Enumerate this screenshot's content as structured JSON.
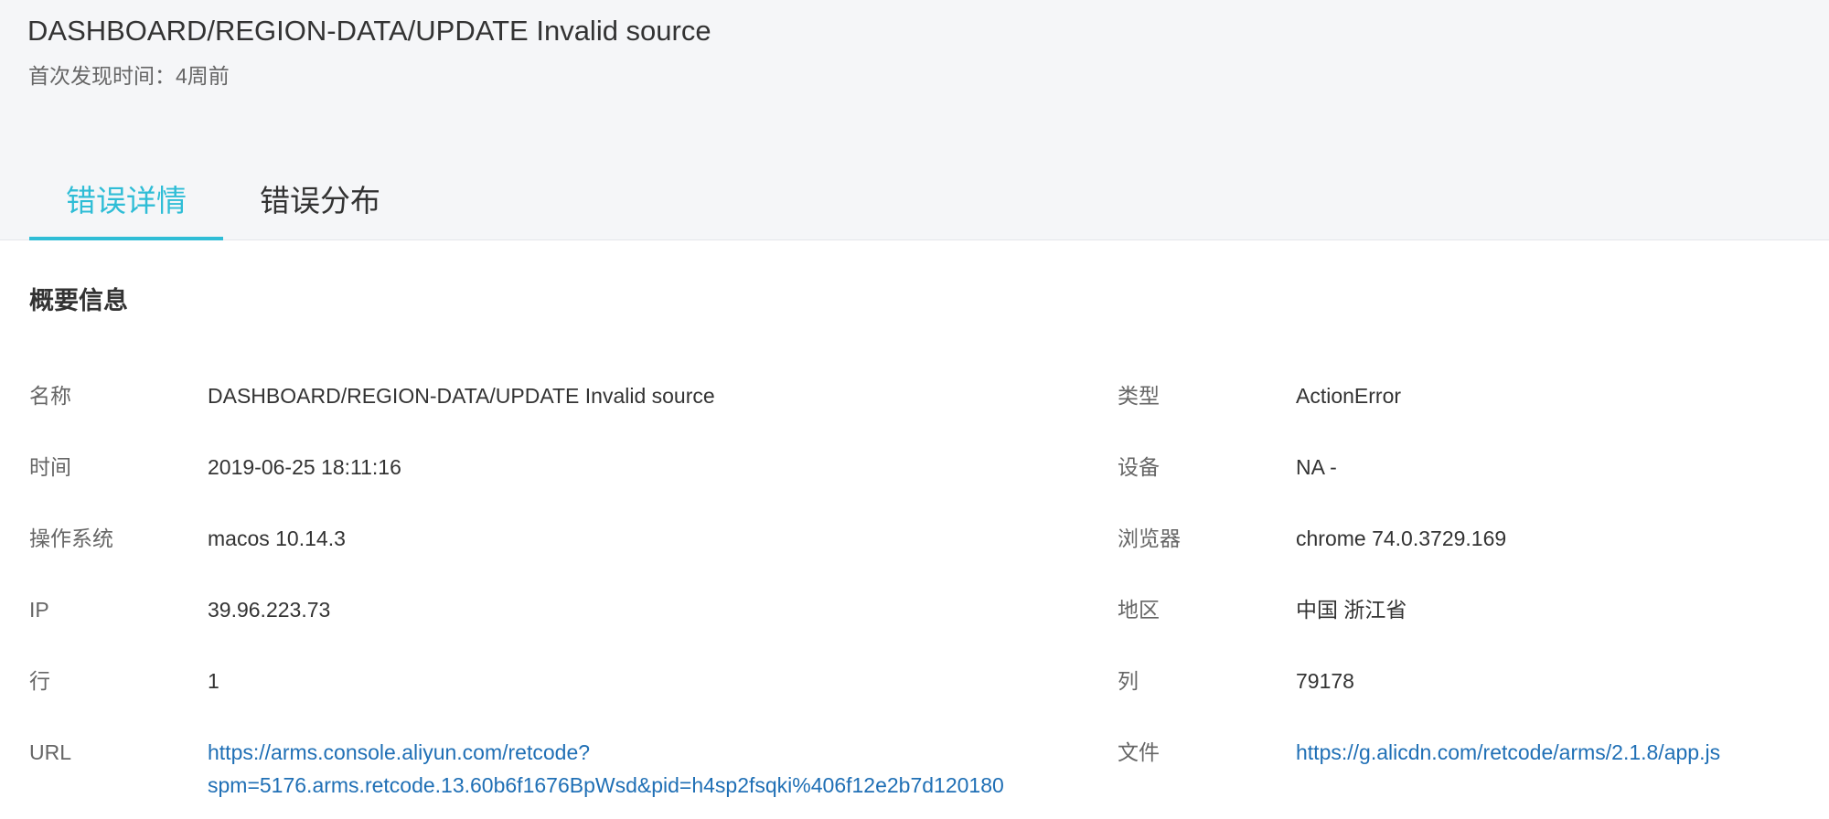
{
  "header": {
    "title": "DASHBOARD/REGION-DATA/UPDATE Invalid source",
    "first_seen": "首次发现时间：4周前"
  },
  "tabs": [
    {
      "label": "错误详情",
      "active": true
    },
    {
      "label": "错误分布",
      "active": false
    }
  ],
  "summary": {
    "title": "概要信息",
    "rows": [
      {
        "left": {
          "label": "名称",
          "value": "DASHBOARD/REGION-DATA/UPDATE Invalid source"
        },
        "right": {
          "label": "类型",
          "value": "ActionError"
        }
      },
      {
        "left": {
          "label": "时间",
          "value": "2019-06-25 18:11:16"
        },
        "right": {
          "label": "设备",
          "value": "NA -"
        }
      },
      {
        "left": {
          "label": "操作系统",
          "value": "macos 10.14.3"
        },
        "right": {
          "label": "浏览器",
          "value": "chrome 74.0.3729.169"
        }
      },
      {
        "left": {
          "label": "IP",
          "value": "39.96.223.73"
        },
        "right": {
          "label": "地区",
          "value": "中国 浙江省"
        }
      },
      {
        "left": {
          "label": "行",
          "value": "1"
        },
        "right": {
          "label": "列",
          "value": "79178"
        }
      }
    ],
    "url": {
      "label": "URL",
      "line1": "https://arms.console.aliyun.com/retcode?",
      "line2": "spm=5176.arms.retcode.13.60b6f1676BpWsd&pid=h4sp2fsqki%406f12e2b7d120180"
    },
    "file": {
      "label": "文件",
      "value": "https://g.alicdn.com/retcode/arms/2.1.8/app.js"
    }
  },
  "colors": {
    "accent": "#2fbdd6",
    "link": "#1f6fb5",
    "header_bg": "#f5f6f8"
  }
}
